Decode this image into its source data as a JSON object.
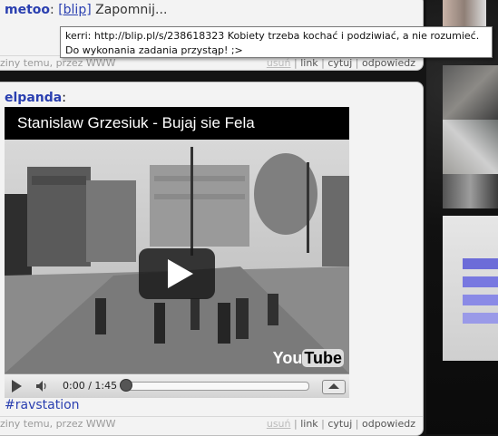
{
  "post1": {
    "author": "metoo",
    "separator": ":",
    "link": "[blip]",
    "text": "Zapomnij..."
  },
  "tooltip": {
    "text": "kerri: http://blip.pl/s/238618323 Kobiety trzeba kochać i podziwiać, a nie rozumieć. Do wykonania zadania przystąp! ;>"
  },
  "footer1": {
    "left": "ziny temu, przez WWW",
    "delete": "usuń",
    "link": "link",
    "quote": "cytuj",
    "reply": "odpowiedz"
  },
  "post2": {
    "author": "elpanda",
    "separator": ":",
    "video_title": "Stanislaw Grzesiuk - Bujaj sie Fela",
    "time": "0:00 / 1:45",
    "logo_you": "You",
    "logo_tube": "Tube",
    "hashtag": "#ravstation"
  },
  "footer2": {
    "left": "ziny temu, przez WWW",
    "delete": "usuń",
    "link": "link",
    "quote": "cytuj",
    "reply": "odpowiedz"
  },
  "colors": {
    "link": "#2a3fb0",
    "panel": "#f3f3f3",
    "background": "#141414"
  }
}
